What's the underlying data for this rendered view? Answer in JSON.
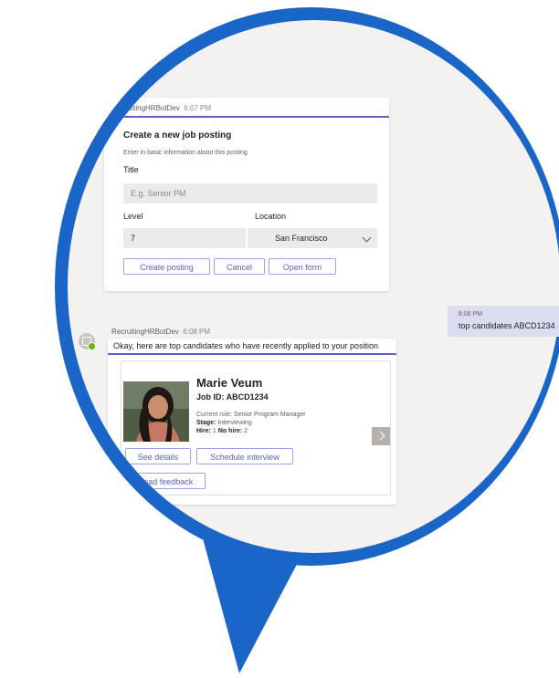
{
  "colors": {
    "accent": "#5b5fc7",
    "bubble": "#1a66c8",
    "background": "#f3f2f1"
  },
  "message1": {
    "sender": "RecruitingHRBotDev",
    "time": "6:07 PM",
    "card": {
      "title": "Create a new job posting",
      "subtitle": "Enter in basic information about this posting",
      "title_label": "Title",
      "title_placeholder": "E.g. Senior PM",
      "level_label": "Level",
      "level_value": "7",
      "location_label": "Location",
      "location_value": "San Francisco",
      "buttons": [
        "Create posting",
        "Cancel",
        "Open form"
      ]
    }
  },
  "user_message": {
    "time": "6:08 PM",
    "text": "top candidates ABCD1234"
  },
  "message2": {
    "sender": "RecruitingHRBotDev",
    "time": "6:08 PM",
    "text": "Okay, here are top candidates who have recently applied to your position",
    "candidate": {
      "name": "Marie Veum",
      "job_id": "Job ID: ABCD1234",
      "current_role": "Current role: Senior Program Manager",
      "stage_label": "Stage:",
      "stage_value": "Interviewing",
      "hire_label": "Hire:",
      "hire_value": "1",
      "nohire_label": "No hire:",
      "nohire_value": "2"
    },
    "buttons": [
      "See details",
      "Schedule interview",
      "Read feedback"
    ]
  }
}
